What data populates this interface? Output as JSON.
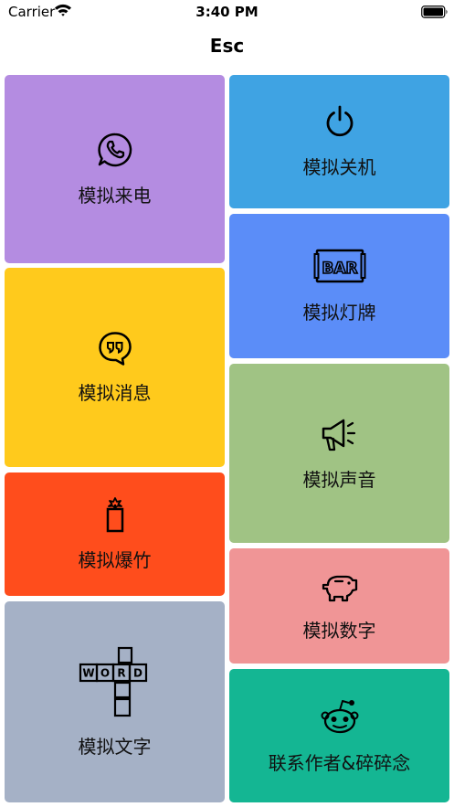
{
  "status_bar": {
    "carrier": "Carrier",
    "time": "3:40 PM"
  },
  "nav": {
    "title": "Esc"
  },
  "tiles": [
    {
      "label": "模拟来电",
      "icon": "phone-chat-icon",
      "color": "#B48CE1"
    },
    {
      "label": "模拟关机",
      "icon": "power-icon",
      "color": "#3FA3E3"
    },
    {
      "label": "模拟灯牌",
      "icon": "bar-sign-icon",
      "color": "#5B8DF8"
    },
    {
      "label": "模拟消息",
      "icon": "quote-bubble-icon",
      "color": "#FFCA1C"
    },
    {
      "label": "模拟声音",
      "icon": "megaphone-icon",
      "color": "#A0C384"
    },
    {
      "label": "模拟爆竹",
      "icon": "firecracker-icon",
      "color": "#FF4D1C"
    },
    {
      "label": "模拟数字",
      "icon": "piggy-bank-icon",
      "color": "#F09596"
    },
    {
      "label": "模拟文字",
      "icon": "crossword-icon",
      "color": "#A5B1C6",
      "icon_text": "WORD"
    },
    {
      "label": "联系作者&碎碎念",
      "icon": "reddit-alien-icon",
      "color": "#14B693"
    }
  ]
}
